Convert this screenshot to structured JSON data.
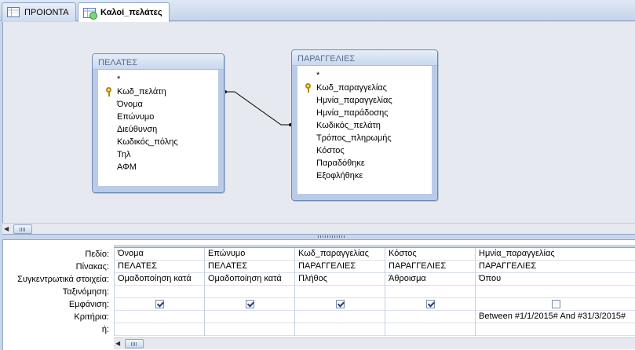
{
  "tabs": [
    {
      "label": "ΠΡΟΙΟΝΤΑ",
      "active": false,
      "icon": "table-icon"
    },
    {
      "label": "Καλοί_πελάτες",
      "active": true,
      "icon": "query-icon"
    }
  ],
  "tables": [
    {
      "name": "ΠΕΛΑΤΕΣ",
      "fields": [
        "*",
        "Κωδ_πελάτη",
        "Όνομα",
        "Επώνυμο",
        "Διεύθυνση",
        "Κωδικός_πόλης",
        "Τηλ",
        "ΑΦΜ"
      ],
      "key_field": "Κωδ_πελάτη"
    },
    {
      "name": "ΠΑΡΑΓΓΕΛΙΕΣ",
      "fields": [
        "*",
        "Κωδ_παραγγελίας",
        "Ημνία_παραγγελίας",
        "Ημνία_παράδοσης",
        "Κωδικός_πελάτη",
        "Τρόπος_πληρωμής",
        "Κόστος",
        "Παραδόθηκε",
        "Εξοφλήθηκε"
      ],
      "key_field": "Κωδ_παραγγελίας"
    }
  ],
  "grid": {
    "row_labels": [
      "Πεδίο:",
      "Πίνακας:",
      "Συγκεντρωτικά στοιχεία:",
      "Ταξινόμηση:",
      "Εμφάνιση:",
      "Κριτήρια:",
      "ή:"
    ],
    "columns": [
      {
        "field": "Όνομα",
        "table": "ΠΕΛΑΤΕΣ",
        "total": "Ομαδοποίηση κατά",
        "sort": "",
        "show": true,
        "criteria": "",
        "or": ""
      },
      {
        "field": "Επώνυμο",
        "table": "ΠΕΛΑΤΕΣ",
        "total": "Ομαδοποίηση κατά",
        "sort": "",
        "show": true,
        "criteria": "",
        "or": ""
      },
      {
        "field": "Κωδ_παραγγελίας",
        "table": "ΠΑΡΑΓΓΕΛΙΕΣ",
        "total": "Πλήθος",
        "sort": "",
        "show": true,
        "criteria": "",
        "or": ""
      },
      {
        "field": "Κόστος",
        "table": "ΠΑΡΑΓΓΕΛΙΕΣ",
        "total": "Άθροισμα",
        "sort": "",
        "show": true,
        "criteria": "",
        "or": ""
      },
      {
        "field": "Ημνία_παραγγελίας",
        "table": "ΠΑΡΑΓΓΕΛΙΕΣ",
        "total": "Όπου",
        "sort": "",
        "show": false,
        "criteria": "Between #1/1/2015# And #31/3/2015#",
        "or": ""
      }
    ]
  }
}
